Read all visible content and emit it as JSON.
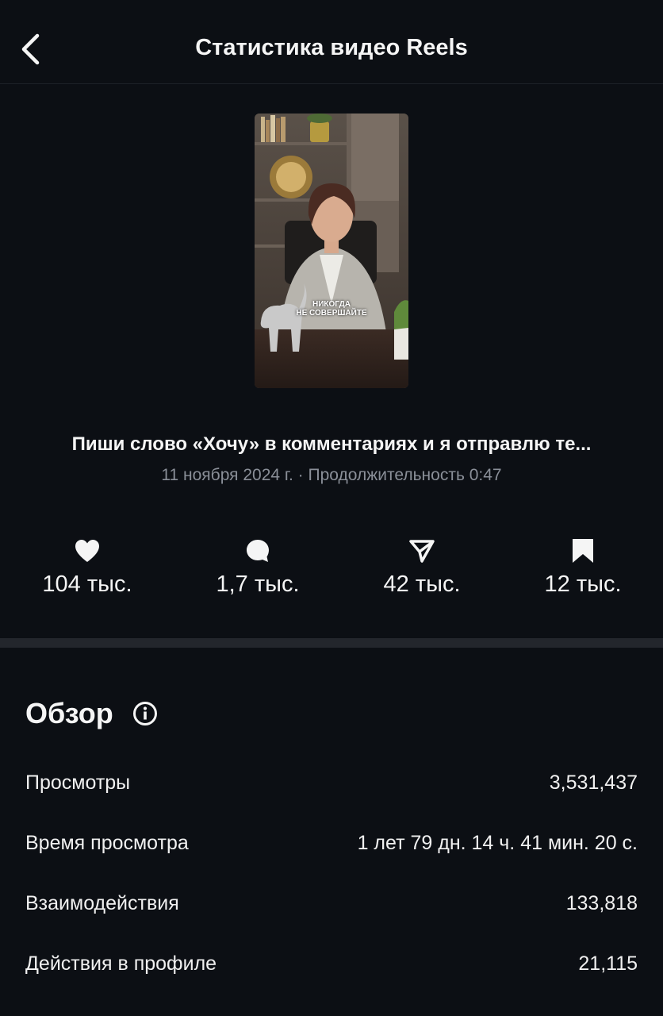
{
  "header": {
    "title": "Статистика видео Reels",
    "back_icon": "chevron-left-icon"
  },
  "thumbnail": {
    "caption_line1": "НИКОГДА",
    "caption_line2": "НЕ СОВЕРШАЙТЕ"
  },
  "post": {
    "title": "Пиши слово «Хочу» в комментариях и я отправлю те...",
    "meta": "11 ноября 2024 г. · Продолжительность 0:47"
  },
  "metrics": [
    {
      "icon": "heart-icon",
      "value": "104 тыс."
    },
    {
      "icon": "comment-icon",
      "value": "1,7 тыс."
    },
    {
      "icon": "send-icon",
      "value": "42 тыс."
    },
    {
      "icon": "bookmark-icon",
      "value": "12 тыс."
    }
  ],
  "overview": {
    "title": "Обзор",
    "info_icon": "info-icon",
    "rows": [
      {
        "label": "Просмотры",
        "value": "3,531,437"
      },
      {
        "label": "Время просмотра",
        "value": "1 лет 79 дн. 14 ч. 41 мин. 20 с."
      },
      {
        "label": "Взаимодействия",
        "value": "133,818"
      },
      {
        "label": "Действия в профиле",
        "value": "21,115"
      }
    ]
  },
  "colors": {
    "background": "#0c0f14",
    "text": "#f5f5f5",
    "muted": "#8a8f98",
    "divider": "#23262c"
  }
}
